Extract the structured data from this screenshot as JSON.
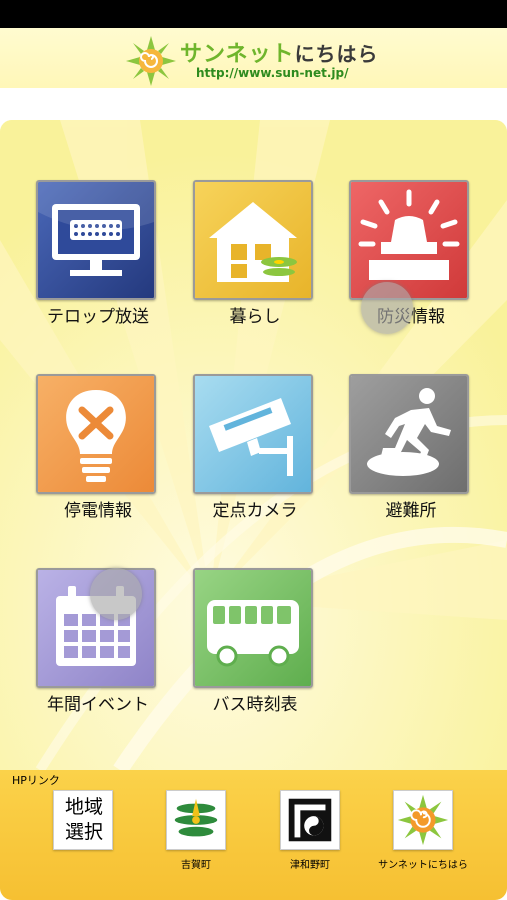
{
  "header": {
    "logo_title": "サンネット",
    "logo_title_suffix": "にちはら",
    "logo_url": "http://www.sun-net.jp/"
  },
  "menu": {
    "tiles": [
      {
        "label": "テロップ放送",
        "icon": "tv-icon",
        "color": "#2f4a9a"
      },
      {
        "label": "暮らし",
        "icon": "house-icon",
        "color": "#f0c43a"
      },
      {
        "label": "防災情報",
        "icon": "siren-icon",
        "color": "#e05050"
      },
      {
        "label": "停電情報",
        "icon": "lightbulb-icon",
        "color": "#f29a4a"
      },
      {
        "label": "定点カメラ",
        "icon": "camera-icon",
        "color": "#7fc8e6"
      },
      {
        "label": "避難所",
        "icon": "evacuation-icon",
        "color": "#8c8c8c"
      },
      {
        "label": "年間イベント",
        "icon": "calendar-icon",
        "color": "#a49ad6"
      },
      {
        "label": "バス時刻表",
        "icon": "bus-icon",
        "color": "#7fc46a"
      }
    ]
  },
  "footer": {
    "title": "HPリンク",
    "links": [
      {
        "label": "",
        "box_text_line1": "地域",
        "box_text_line2": "選択"
      },
      {
        "label": "吉賀町"
      },
      {
        "label": "津和野町"
      },
      {
        "label": "サンネットにちはら"
      }
    ]
  }
}
